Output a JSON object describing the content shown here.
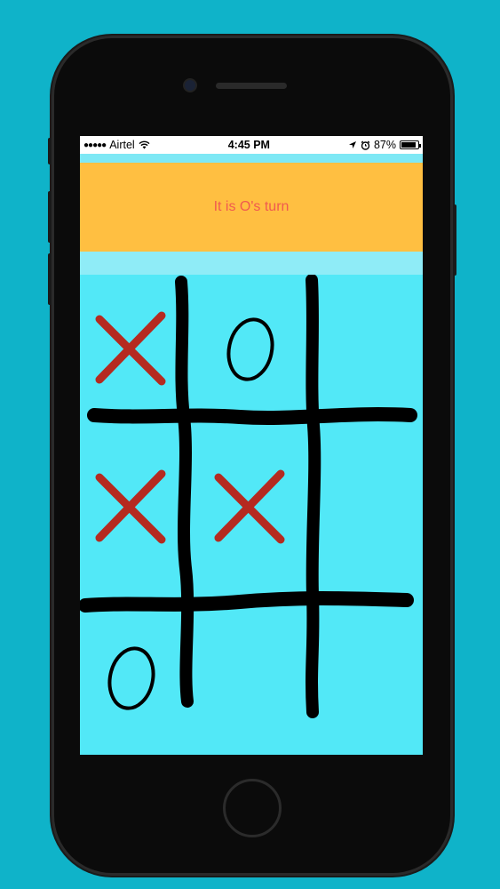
{
  "status_bar": {
    "carrier": "Airtel",
    "time": "4:45 PM",
    "battery_percent": "87%",
    "battery_level": 0.87,
    "icons": [
      "signal-dots-icon",
      "wifi-icon",
      "location-arrow-icon",
      "alarm-clock-icon",
      "battery-icon"
    ]
  },
  "header": {
    "turn_text": "It is O's turn"
  },
  "board": {
    "cells": [
      "X",
      "O",
      "",
      "X",
      "X",
      "",
      "O",
      "",
      ""
    ]
  },
  "colors": {
    "background": "#0fb3c9",
    "header": "#ffbf41",
    "board": "#52e8f7",
    "turn_text": "#f05a4f",
    "x_mark": "#b52a20",
    "o_mark": "#000000",
    "grid": "#000000"
  }
}
